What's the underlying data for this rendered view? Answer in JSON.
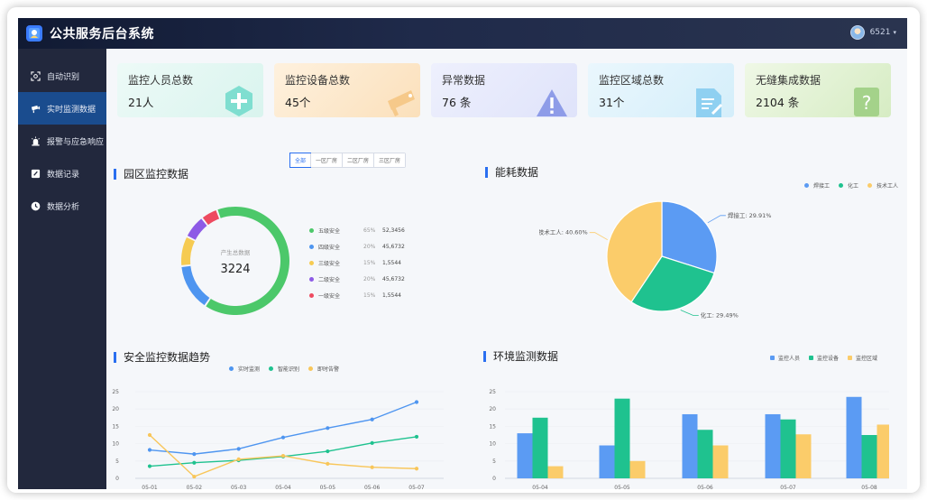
{
  "app": {
    "title": "公共服务后台系统",
    "user": "6521"
  },
  "colors": {
    "accent": "#2a6ff0",
    "sidebar_bg": "#22283d",
    "sidebar_active": "#1a4c8e"
  },
  "sidebar": {
    "items": [
      {
        "label": "自动识别",
        "icon": "face-scan-icon"
      },
      {
        "label": "实时监测数据",
        "icon": "camera-icon",
        "active": true
      },
      {
        "label": "报警与应急响应",
        "icon": "alarm-icon"
      },
      {
        "label": "数据记录",
        "icon": "edit-icon"
      },
      {
        "label": "数据分析",
        "icon": "clock-icon"
      }
    ]
  },
  "stats": [
    {
      "label": "监控人员总数",
      "value": "21人",
      "icon": "plus-hexagon-icon",
      "bg": "#e4f7f3"
    },
    {
      "label": "监控设备总数",
      "value": "45个",
      "icon": "camera-icon",
      "bg": "#fde9cf"
    },
    {
      "label": "异常数据",
      "value": "76 条",
      "icon": "warning-icon",
      "bg": "#e6e8fb"
    },
    {
      "label": "监控区域总数",
      "value": "31个",
      "icon": "document-icon",
      "bg": "#e2f3fb"
    },
    {
      "label": "无缝集成数据",
      "value": "2104 条",
      "icon": "question-icon",
      "bg": "#e7f3dc"
    }
  ],
  "park": {
    "title": "园区监控数据",
    "tabs": [
      "全部",
      "一区厂房",
      "二区厂房",
      "三区厂房"
    ],
    "center_label": "产生总数据",
    "center_value": "3224"
  },
  "energy": {
    "title": "能耗数据"
  },
  "trend": {
    "title": "安全监控数据趋势"
  },
  "env": {
    "title": "环境监测数据"
  },
  "chart_data": [
    {
      "type": "pie",
      "variant": "donut",
      "labels": [
        "五级安全",
        "四级安全",
        "三级安全",
        "二级安全",
        "一级安全"
      ],
      "percents": [
        "65%",
        "20%",
        "15%",
        "20%",
        "15%"
      ],
      "values": [
        "52,3456",
        "45,6732",
        "1,5544",
        "45,6732",
        "1,5544"
      ],
      "slice_share": [
        0.65,
        0.14,
        0.09,
        0.07,
        0.05
      ],
      "colors": [
        "#4cc86a",
        "#4e95f0",
        "#f6cb52",
        "#8d5ae6",
        "#ee4a60"
      ],
      "legend": "right"
    },
    {
      "type": "pie",
      "labels": [
        "焊接工",
        "化工",
        "技术工人"
      ],
      "values": [
        29.91,
        29.49,
        40.6
      ],
      "display": [
        "29.91%",
        "29.49%",
        "40.60%"
      ],
      "colors": [
        "#5b9bf3",
        "#1fc28f",
        "#fbcc6a"
      ],
      "legend": "top-right"
    },
    {
      "type": "line",
      "categories": [
        "05-01",
        "05-02",
        "05-03",
        "05-04",
        "05-05",
        "05-06",
        "05-07"
      ],
      "series": [
        {
          "name": "实时监测",
          "color": "#4e95f0",
          "values": [
            8.2,
            7,
            8.5,
            11.8,
            14.5,
            17,
            22
          ]
        },
        {
          "name": "智能识别",
          "color": "#1fc28f",
          "values": [
            3.5,
            4.5,
            5.2,
            6.3,
            7.8,
            10.2,
            12
          ]
        },
        {
          "name": "即时告警",
          "color": "#f8c65a",
          "values": [
            12.5,
            0.5,
            5.5,
            6.5,
            4.2,
            3.2,
            2.8
          ]
        }
      ],
      "yticks": [
        0,
        5,
        10,
        15,
        20,
        25
      ],
      "ylim": [
        0,
        25
      ],
      "legend": "top-center"
    },
    {
      "type": "bar",
      "categories": [
        "05-04",
        "05-05",
        "05-06",
        "05-07",
        "05-08"
      ],
      "series": [
        {
          "name": "监控人员",
          "color": "#5b9bf3",
          "values": [
            13,
            9.5,
            18.5,
            18.5,
            23.5
          ]
        },
        {
          "name": "监控设备",
          "color": "#1fc28f",
          "values": [
            17.5,
            23,
            14,
            17,
            12.5
          ]
        },
        {
          "name": "监控区域",
          "color": "#fbcc6a",
          "values": [
            3.5,
            5,
            9.5,
            12.7,
            15.5
          ]
        }
      ],
      "yticks": [
        0,
        5,
        10,
        15,
        20,
        25
      ],
      "ylim": [
        0,
        25
      ],
      "legend": "top-right"
    }
  ]
}
